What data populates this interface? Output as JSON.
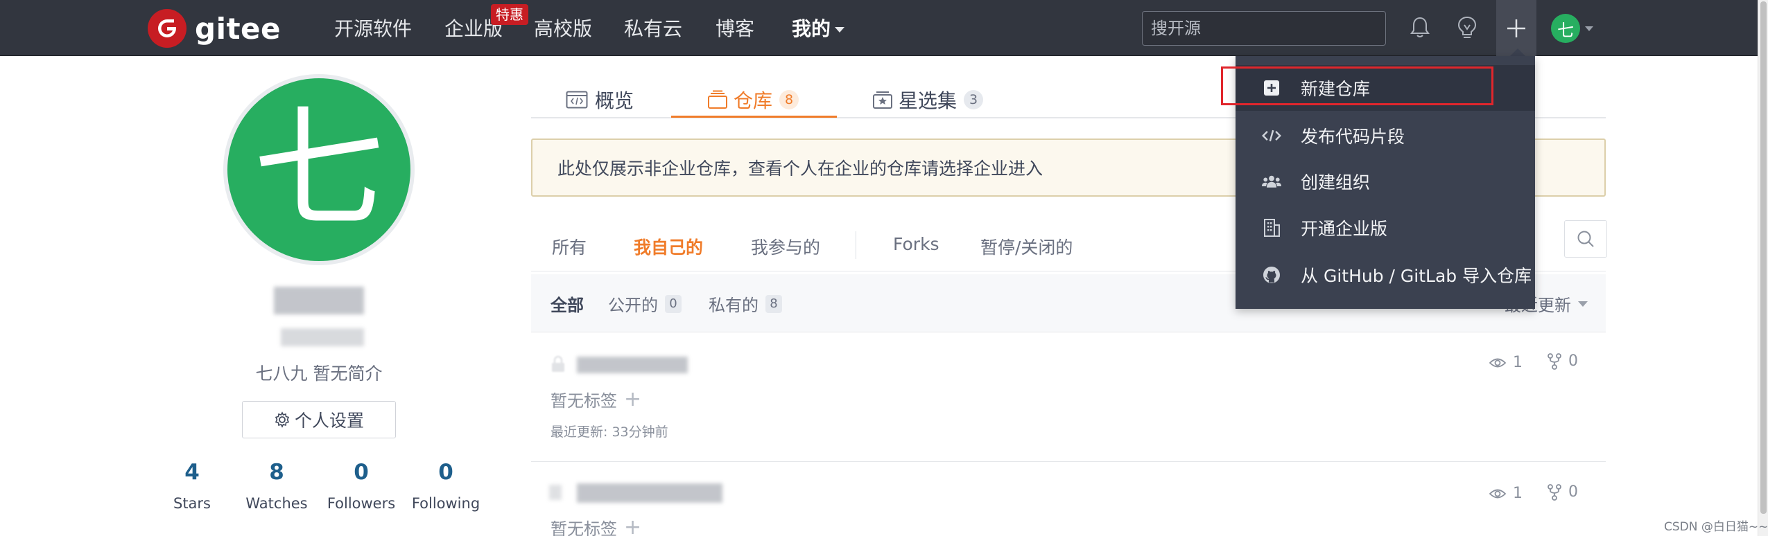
{
  "header": {
    "logo_text": "gitee",
    "nav": [
      {
        "label": "开源软件"
      },
      {
        "label": "企业版",
        "badge": "特惠"
      },
      {
        "label": "高校版"
      },
      {
        "label": "私有云"
      },
      {
        "label": "博客"
      },
      {
        "label": "我的"
      }
    ],
    "search_placeholder": "搜开源",
    "user_avatar": "七"
  },
  "profile": {
    "avatar_char": "七",
    "bio": "七八九 暂无简介",
    "settings_label": "个人设置",
    "stats": [
      {
        "value": "4",
        "label": "Stars"
      },
      {
        "value": "8",
        "label": "Watches"
      },
      {
        "value": "0",
        "label": "Followers"
      },
      {
        "value": "0",
        "label": "Following"
      }
    ]
  },
  "tabs": [
    {
      "label": "概览"
    },
    {
      "label": "仓库",
      "count": "8"
    },
    {
      "label": "星选集",
      "count": "3"
    }
  ],
  "notice": "此处仅展示非企业仓库，查看个人在企业的仓库请选择企业进入",
  "filters": [
    "所有",
    "我自己的",
    "我参与的",
    "Forks",
    "暂停/关闭的"
  ],
  "sub_filters": [
    {
      "label": "全部"
    },
    {
      "label": "公开的",
      "count": "0"
    },
    {
      "label": "私有的",
      "count": "8"
    }
  ],
  "sort_label": "最近更新",
  "repos": [
    {
      "tag_text": "暂无标签",
      "updated": "最近更新: 33分钟前",
      "watch": "1",
      "fork": "0"
    },
    {
      "tag_text": "暂无标签",
      "updated": "",
      "watch": "1",
      "fork": "0"
    }
  ],
  "dropdown": [
    {
      "label": "新建仓库",
      "icon": "plus-square-icon"
    },
    {
      "label": "发布代码片段",
      "icon": "code-icon"
    },
    {
      "label": "创建组织",
      "icon": "users-icon"
    },
    {
      "label": "开通企业版",
      "icon": "building-icon"
    },
    {
      "label": "从 GitHub / GitLab 导入仓库",
      "icon": "github-icon"
    }
  ],
  "watermark": "CSDN @白日猫~~",
  "colors": {
    "header_bg": "#32363f",
    "accent": "#f07c2a",
    "brand_red": "#c71d23",
    "avatar_green": "#27ae60",
    "dropdown_bg": "#3b4150",
    "highlight_box": "#e0262c"
  }
}
